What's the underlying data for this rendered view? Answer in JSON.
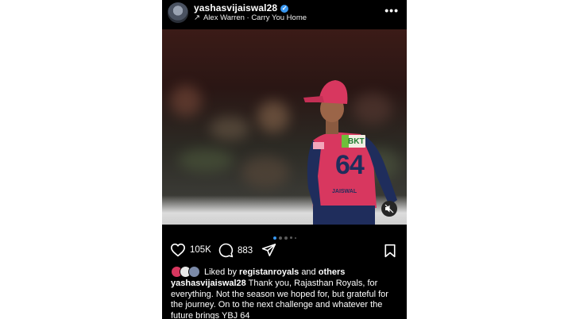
{
  "post": {
    "username": "yashasvijaiswal28",
    "music": "Alex Warren · Carry You Home",
    "more_icon": "more-icon"
  },
  "photo": {
    "jersey_sponsor": "BKT",
    "jersey_number": "64",
    "jersey_name": "JAISWAL"
  },
  "carousel": {
    "total": 5,
    "active_index": 0
  },
  "actions": {
    "likes_count": "105K",
    "comments_count": "883"
  },
  "liked_by": {
    "prefix": "Liked by",
    "user": "registanroyals",
    "and": "and",
    "others": "others"
  },
  "caption": {
    "username": "yashasvijaiswal28",
    "text": "Thank you, Rajasthan Royals, for everything. Not the season we hoped for, but grateful for the journey. On to the next challenge and whatever the future brings YBJ 64"
  },
  "colors": {
    "accent": "#3897f0",
    "background": "#000000",
    "jersey_pink": "#d8375f",
    "jersey_navy": "#1f2d5c"
  }
}
